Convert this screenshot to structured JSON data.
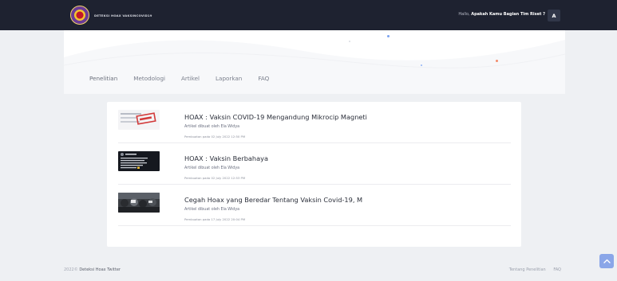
{
  "header": {
    "brand": "DETEKSI HOAX VAKSINCOVID19",
    "greeting_prefix": "Hallo, ",
    "greeting_question": "Apakah Kamu Bagian Tim Riset ?",
    "avatar_letter": "A"
  },
  "nav": {
    "items": [
      "Penelitian",
      "Metodologi",
      "Artikel",
      "Laporkan",
      "FAQ"
    ]
  },
  "articles": [
    {
      "title": "HOAX : Vaksin COVID-19 Mengandung Mikrocip Magneti",
      "author": "Artikel dibuat oleh Ela Widya",
      "date": "Pembuatan pada 02 July 2022 12:50 PM"
    },
    {
      "title": "HOAX : Vaksin Berbahaya",
      "author": "Artikel dibuat oleh Ela Widya",
      "date": "Pembuatan pada 02 July 2022 12:53 PM"
    },
    {
      "title": "Cegah Hoax yang Beredar Tentang Vaksin Covid-19, M",
      "author": "Artikel dibuat oleh Ela Widya",
      "date": "Pembuatan pada 17 July 2022 20:04 PM"
    }
  ],
  "footer": {
    "year": "2022©",
    "site": "Deteksi Hoax Twitter",
    "links": [
      "Tentang Penelitian",
      "FAQ"
    ]
  },
  "icons": {
    "logo": "university-seal-icon",
    "scroll_top": "chevron-up-icon"
  },
  "colors": {
    "topbar": "#1e2230",
    "page_bg": "#eef0f3",
    "scroll_button": "#8aa6e8"
  }
}
